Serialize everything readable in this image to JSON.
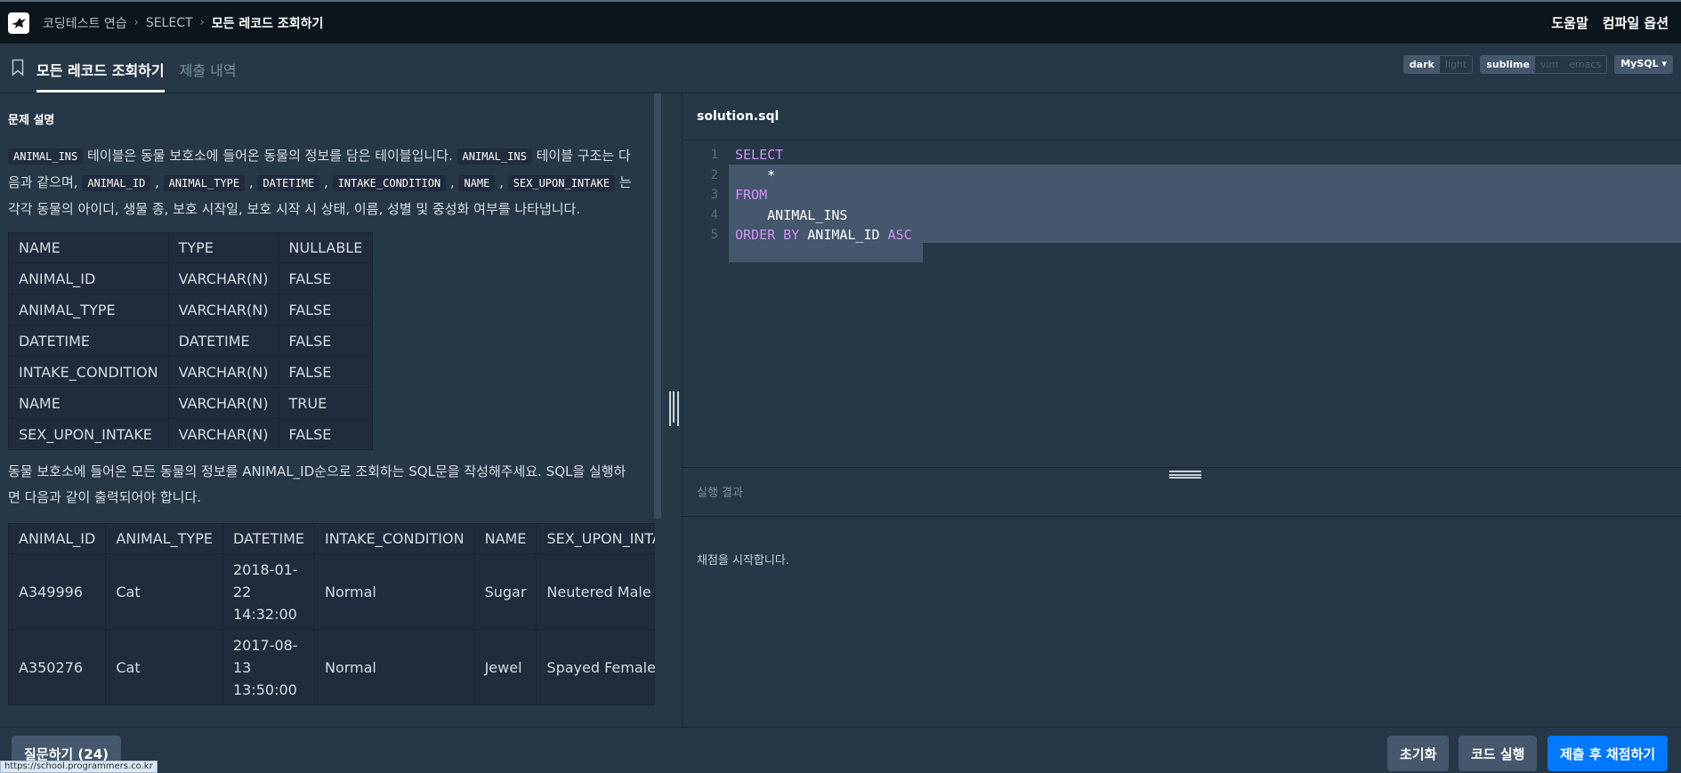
{
  "top_nav": {
    "breadcrumbs": [
      "코딩테스트 연습",
      "SELECT",
      "모든 레코드 조회하기"
    ],
    "help_label": "도움말",
    "compile_options_label": "컴파일 옵션"
  },
  "tabs": {
    "active_label": "모든 레코드 조회하기",
    "submissions_label": "제출 내역"
  },
  "editor_toggles": {
    "theme": [
      "dark",
      "light"
    ],
    "theme_selected": "dark",
    "keymap": [
      "sublime",
      "vim",
      "emacs"
    ],
    "keymap_selected": "sublime",
    "language": "MySQL"
  },
  "problem": {
    "section_title": "문제 설명",
    "p1_code1": "ANIMAL_INS",
    "p1_text1": " 테이블은 동물 보호소에 들어온 동물의 정보를 담은 테이블입니다. ",
    "p1_code2": "ANIMAL_INS",
    "p1_text2": " 테이블 구조는 다음과 같으며, ",
    "p1_code3": "ANIMAL_ID",
    "p1_code4": "ANIMAL_TYPE",
    "p1_code5": "DATETIME",
    "p1_code6": "INTAKE_CONDITION",
    "p1_code7": "NAME",
    "p1_code8": "SEX_UPON_INTAKE",
    "p1_text3": " 는 각각 동물의 아이디, 생물 종, 보호 시작일, 보호 시작 시 상태, 이름, 성별 및 중성화 여부를 나타냅니다.",
    "schema_headers": [
      "NAME",
      "TYPE",
      "NULLABLE"
    ],
    "schema_rows": [
      [
        "ANIMAL_ID",
        "VARCHAR(N)",
        "FALSE"
      ],
      [
        "ANIMAL_TYPE",
        "VARCHAR(N)",
        "FALSE"
      ],
      [
        "DATETIME",
        "DATETIME",
        "FALSE"
      ],
      [
        "INTAKE_CONDITION",
        "VARCHAR(N)",
        "FALSE"
      ],
      [
        "NAME",
        "VARCHAR(N)",
        "TRUE"
      ],
      [
        "SEX_UPON_INTAKE",
        "VARCHAR(N)",
        "FALSE"
      ]
    ],
    "p2": "동물 보호소에 들어온 모든 동물의 정보를 ANIMAL_ID순으로 조회하는 SQL문을 작성해주세요. SQL을 실행하면 다음과 같이 출력되어야 합니다.",
    "result_headers": [
      "ANIMAL_ID",
      "ANIMAL_TYPE",
      "DATETIME",
      "INTAKE_CONDITION",
      "NAME",
      "SEX_UPON_INTAKE"
    ],
    "result_rows": [
      [
        "A349996",
        "Cat",
        "2018-01-22 14:32:00",
        "Normal",
        "Sugar",
        "Neutered Male"
      ],
      [
        "A350276",
        "Cat",
        "2017-08-13 13:50:00",
        "Normal",
        "Jewel",
        "Spayed Female"
      ]
    ]
  },
  "editor": {
    "file_name": "solution.sql",
    "lines": [
      {
        "num": "1",
        "parts": [
          {
            "t": "SELECT",
            "kw": true
          }
        ]
      },
      {
        "num": "2",
        "parts": [
          {
            "t": "    *",
            "kw": false
          }
        ]
      },
      {
        "num": "3",
        "parts": [
          {
            "t": "FROM",
            "kw": true
          }
        ]
      },
      {
        "num": "4",
        "parts": [
          {
            "t": "    ANIMAL_INS",
            "kw": false
          }
        ]
      },
      {
        "num": "5",
        "parts": [
          {
            "t": "ORDER BY",
            "kw": true
          },
          {
            "t": " ANIMAL_ID ",
            "kw": false
          },
          {
            "t": "ASC",
            "kw": true
          }
        ]
      }
    ]
  },
  "results": {
    "label": "실행 결과",
    "text": "채점을 시작합니다."
  },
  "bottom": {
    "ask_label": "질문하기 (24)",
    "reset_label": "초기화",
    "run_label": "코드 실행",
    "submit_label": "제출 후 채점하기",
    "status_url": "https://school.programmers.co.kr"
  },
  "colors": {
    "background": "#263747",
    "nav": "#0c151c",
    "keyword": "#d28ef8",
    "submit_button": "#0078ff"
  }
}
